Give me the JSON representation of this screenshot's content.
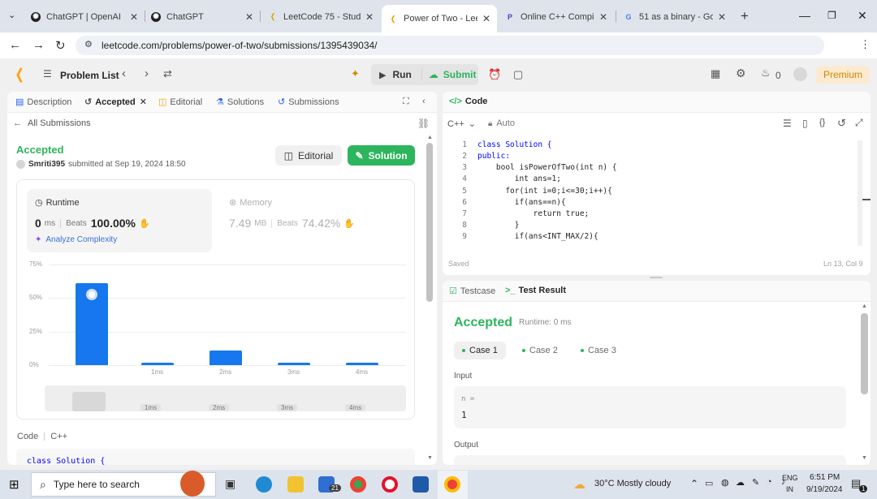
{
  "browser": {
    "tabs": [
      {
        "title": "ChatGPT | OpenAI"
      },
      {
        "title": "ChatGPT"
      },
      {
        "title": "LeetCode 75 - Study P"
      },
      {
        "title": "Power of Two - LeetC"
      },
      {
        "title": "Online C++ Compiler"
      },
      {
        "title": "51 as a binary - Goog"
      }
    ],
    "url": "leetcode.com/problems/power-of-two/submissions/1395439034/"
  },
  "lc_top": {
    "problem_list": "Problem List",
    "run": "Run",
    "submit": "Submit",
    "streak_count": "0",
    "premium": "Premium"
  },
  "left_tabs": [
    "Description",
    "Accepted",
    "Editorial",
    "Solutions",
    "Submissions"
  ],
  "submission": {
    "back_link": "All Submissions",
    "status": "Accepted",
    "user": "Smriti395",
    "submitted_at": "submitted at Sep 19, 2024 18:50",
    "editorial_btn": "Editorial",
    "solution_btn": "Solution",
    "runtime_label": "Runtime",
    "runtime_value": "0",
    "runtime_unit": "ms",
    "beats_label": "Beats",
    "runtime_beats": "100.00%",
    "memory_label": "Memory",
    "memory_value": "7.49",
    "memory_unit": "MB",
    "memory_beats": "74.42%",
    "analyze": "Analyze Complexity",
    "code_label": "Code",
    "lang_label": "C++",
    "code_preview": "class Solution {"
  },
  "chart_data": {
    "type": "bar",
    "categories": [
      "0ms",
      "1ms",
      "2ms",
      "3ms",
      "4ms"
    ],
    "x_tick_labels": [
      "",
      "1ms",
      "2ms",
      "3ms",
      "4ms"
    ],
    "values": [
      61,
      2,
      11,
      2,
      2
    ],
    "y_ticks": [
      "75%",
      "50%",
      "25%",
      "0%"
    ],
    "ylim": [
      0,
      75
    ],
    "grid": true
  },
  "code_panel": {
    "title": "Code",
    "lang": "C++",
    "mode": "Auto",
    "lines": [
      "class Solution {",
      "public:",
      "    bool isPowerOfTwo(int n) {",
      "        int ans=1;",
      "      for(int i=0;i<=30;i++){",
      "        if(ans==n){",
      "            return true;",
      "        }",
      "        if(ans<INT_MAX/2){"
    ],
    "line_numbers": [
      "1",
      "2",
      "3",
      "4",
      "5",
      "6",
      "7",
      "8",
      "9"
    ],
    "saved": "Saved",
    "cursor": "Ln 13, Col 9"
  },
  "result_panel": {
    "tab_testcase": "Testcase",
    "tab_result": "Test Result",
    "status": "Accepted",
    "runtime": "Runtime: 0 ms",
    "cases": [
      "Case 1",
      "Case 2",
      "Case 3"
    ],
    "input_label": "Input",
    "input_var": "n =",
    "input_value": "1",
    "output_label": "Output"
  },
  "taskbar": {
    "search_placeholder": "Type here to search",
    "mail_badge": "21",
    "weather": "30°C  Mostly cloudy",
    "lang_top": "ENG",
    "lang_bottom": "IN",
    "time": "6:51 PM",
    "date": "9/19/2024",
    "notif_count": "1"
  },
  "colors": {
    "accent_green": "#2db55d",
    "bar_blue": "#1677ee",
    "premium_orange": "#ca8a04"
  }
}
